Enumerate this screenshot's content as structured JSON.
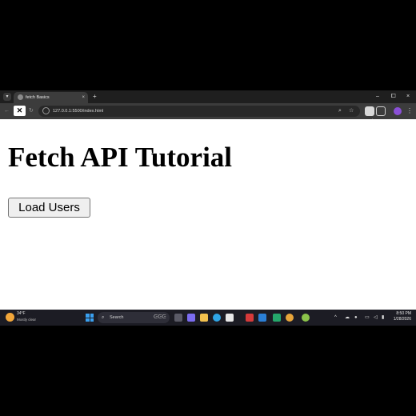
{
  "browser": {
    "tab_title": "fetch Basics",
    "tab_close": "×",
    "new_tab": "+",
    "url": "127.0.0.1:5500/index.html",
    "window_controls": {
      "minimize": "–",
      "maximize": "⧠",
      "close": "×"
    },
    "icons": [
      "back-icon",
      "refresh-icon",
      "capcut-icon",
      "site-info-icon",
      "zoom-icon",
      "star-icon",
      "extension-icon",
      "profile-icon",
      "menu-icon"
    ]
  },
  "page": {
    "heading": "Fetch API Tutorial",
    "load_button": "Load Users"
  },
  "taskbar": {
    "weather_temp": "34°F",
    "weather_desc": "Mostly clear",
    "search_label": "Search",
    "time": "8:50 PM",
    "date": "1/28/2026"
  },
  "colors": {
    "chrome_dark": "#1f1f1f",
    "toolbar": "#3c3c3c",
    "page_bg": "#ffffff",
    "button_bg": "#efefef",
    "taskbar": "#1c1c24"
  }
}
